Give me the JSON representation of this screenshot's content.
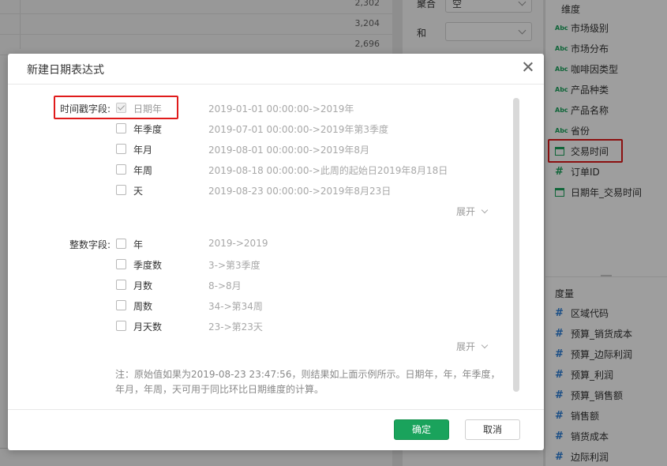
{
  "background": {
    "table_values": [
      "2,302",
      "3,204",
      "2,696"
    ],
    "mid_panel": {
      "row1_label": "聚合",
      "row1_value": "空",
      "row2_label": "和"
    },
    "dimension_title": "维度",
    "dimensions": [
      {
        "icon": "Abc",
        "label": "市场级别"
      },
      {
        "icon": "Abc",
        "label": "市场分布"
      },
      {
        "icon": "Abc",
        "label": "咖啡因类型"
      },
      {
        "icon": "Abc",
        "label": "产品种类"
      },
      {
        "icon": "Abc",
        "label": "产品名称"
      },
      {
        "icon": "Abc",
        "label": "省份"
      },
      {
        "icon": "calendar",
        "label": "交易时间"
      },
      {
        "icon": "#",
        "label": "订单ID"
      },
      {
        "icon": "calendar",
        "label": "日期年_交易时间"
      }
    ],
    "measure_title": "度量",
    "measures": [
      {
        "icon": "#",
        "label": "区域代码"
      },
      {
        "icon": "#",
        "label": "预算_销货成本"
      },
      {
        "icon": "#",
        "label": "预算_边际利润"
      },
      {
        "icon": "#",
        "label": "预算_利润"
      },
      {
        "icon": "#",
        "label": "预算_销售额"
      },
      {
        "icon": "#",
        "label": "销售额"
      },
      {
        "icon": "#",
        "label": "销货成本"
      },
      {
        "icon": "#",
        "label": "边际利润"
      }
    ]
  },
  "dialog": {
    "title": "新建日期表达式",
    "timestamp_group_label": "时间戳字段:",
    "timestamp_options": [
      {
        "label": "日期年",
        "example": "2019-01-01 00:00:00->2019年",
        "checked": true,
        "disabled": true
      },
      {
        "label": "年季度",
        "example": "2019-07-01 00:00:00->2019年第3季度",
        "checked": false
      },
      {
        "label": "年月",
        "example": "2019-08-01 00:00:00->2019年8月",
        "checked": false
      },
      {
        "label": "年周",
        "example": "2019-08-18 00:00:00->此周的起始日2019年8月18日",
        "checked": false
      },
      {
        "label": "天",
        "example": "2019-08-23 00:00:00->2019年8月23日",
        "checked": false
      }
    ],
    "expand_label_1": "展开",
    "integer_group_label": "整数字段:",
    "integer_options": [
      {
        "label": "年",
        "example": "2019->2019",
        "checked": false
      },
      {
        "label": "季度数",
        "example": "3->第3季度",
        "checked": false
      },
      {
        "label": "月数",
        "example": "8->8月",
        "checked": false
      },
      {
        "label": "周数",
        "example": "34->第34周",
        "checked": false
      },
      {
        "label": "月天数",
        "example": "23->第23天",
        "checked": false
      }
    ],
    "expand_label_2": "展开",
    "note": "注：原始值如果为2019-08-23 23:47:56，则结果如上面示例所示。日期年，年，年季度，年月，年周，天可用于同比环比日期维度的计算。",
    "ok_label": "确定",
    "cancel_label": "取消"
  },
  "colors": {
    "accent": "#1aa35c",
    "highlight": "#e01b1b"
  }
}
